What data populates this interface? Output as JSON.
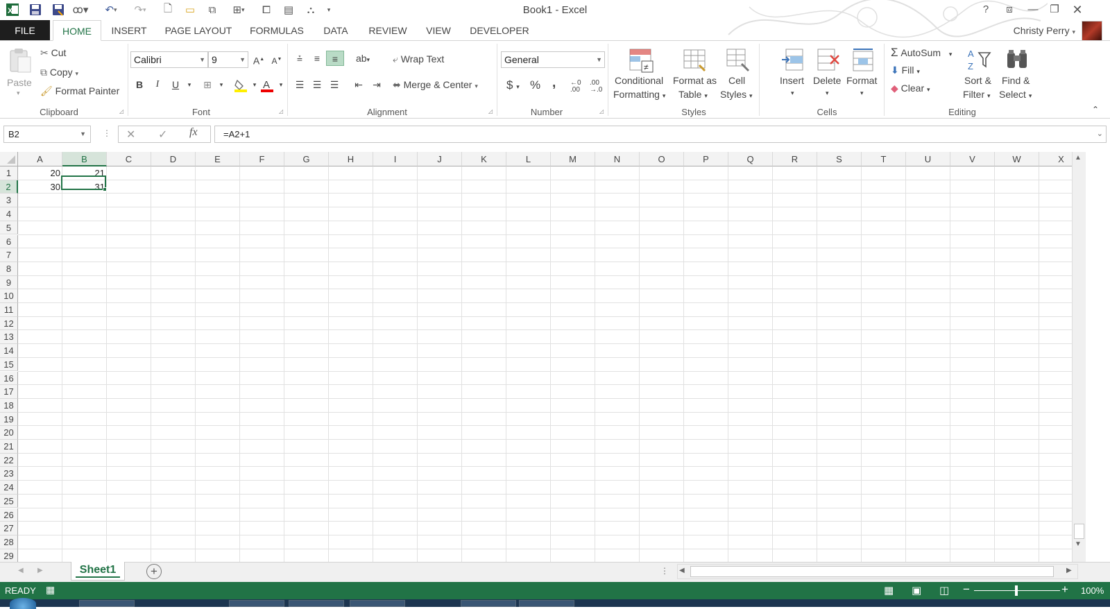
{
  "window": {
    "title": "Book1 - Excel",
    "help": "?",
    "user_name": "Christy Perry"
  },
  "tabs": [
    "FILE",
    "HOME",
    "INSERT",
    "PAGE LAYOUT",
    "FORMULAS",
    "DATA",
    "REVIEW",
    "VIEW",
    "DEVELOPER"
  ],
  "ribbon": {
    "clipboard": {
      "label": "Clipboard",
      "paste": "Paste",
      "cut": "Cut",
      "copy": "Copy",
      "format_painter": "Format Painter"
    },
    "font": {
      "label": "Font",
      "font_name": "Calibri",
      "font_size": "9",
      "bold": "B",
      "italic": "I",
      "underline": "U"
    },
    "alignment": {
      "label": "Alignment",
      "wrap_text": "Wrap Text",
      "merge_center": "Merge & Center"
    },
    "number": {
      "label": "Number",
      "format": "General",
      "currency": "$",
      "percent": "%",
      "comma": ","
    },
    "styles": {
      "label": "Styles",
      "conditional_1": "Conditional",
      "conditional_2": "Formatting",
      "format_table_1": "Format as",
      "format_table_2": "Table",
      "cell_styles_1": "Cell",
      "cell_styles_2": "Styles"
    },
    "cells": {
      "label": "Cells",
      "insert": "Insert",
      "delete": "Delete",
      "format": "Format"
    },
    "editing": {
      "label": "Editing",
      "autosum": "AutoSum",
      "fill": "Fill",
      "clear": "Clear",
      "sort_1": "Sort &",
      "sort_2": "Filter",
      "find_1": "Find &",
      "find_2": "Select"
    }
  },
  "formula_bar": {
    "name_box": "B2",
    "formula": "=A2+1",
    "fx": "fx"
  },
  "columns": [
    "A",
    "B",
    "C",
    "D",
    "E",
    "F",
    "G",
    "H",
    "I",
    "J",
    "K",
    "L",
    "M",
    "N",
    "O",
    "P",
    "Q",
    "R",
    "S",
    "T",
    "U",
    "V",
    "W",
    "X"
  ],
  "rows": [
    "1",
    "2",
    "3",
    "4",
    "5",
    "6",
    "7",
    "8",
    "9",
    "10",
    "11",
    "12",
    "13",
    "14",
    "15",
    "16",
    "17",
    "18",
    "19",
    "20",
    "21",
    "22",
    "23",
    "24",
    "25",
    "26",
    "27",
    "28",
    "29"
  ],
  "cells": {
    "A1": "20",
    "B1": "21",
    "A2": "30",
    "B2": "31"
  },
  "selected_cell": "B2",
  "sheets": [
    "Sheet1"
  ],
  "status": {
    "mode": "READY",
    "zoom": "100%"
  },
  "colors": {
    "accent": "#217346",
    "file_tab": "#1e1e1e"
  }
}
